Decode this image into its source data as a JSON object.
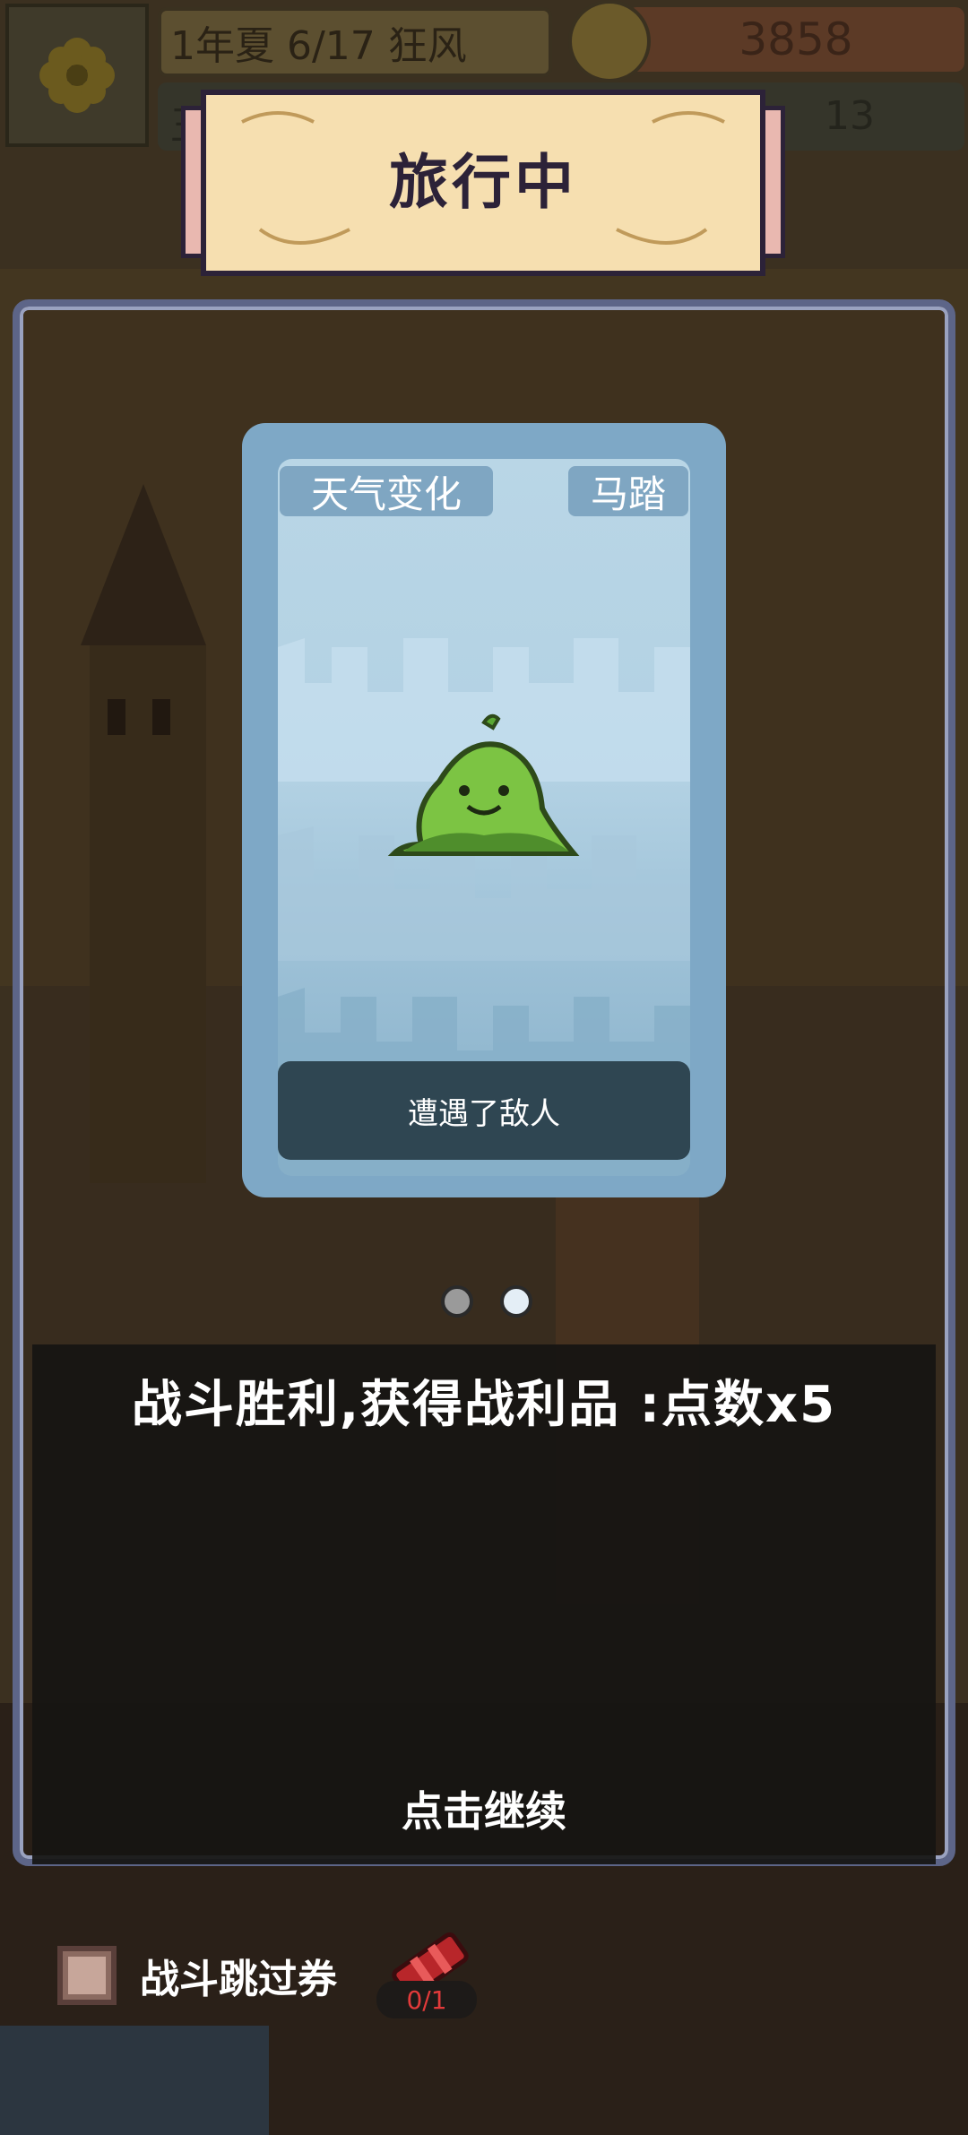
{
  "hud": {
    "date": "1年夏 6/17 狂风",
    "money": "3858",
    "sub_left": "王",
    "sub_right": "13"
  },
  "banner": {
    "title": "旅行中"
  },
  "card": {
    "tag_weather": "天气变化",
    "tag_road": "马踏",
    "event": "遭遇了敌人"
  },
  "pager": {
    "current": 2,
    "total": 2
  },
  "dialog": {
    "result": "战斗胜利,获得战利品 :点数x5",
    "continue": "点击继续"
  },
  "skip": {
    "label": "战斗跳过券",
    "count": "0/1"
  },
  "colors": {
    "panel_border": "#5d6588",
    "card_bg": "#7ea8c6",
    "banner_bg": "#f6dfb0",
    "slime": "#7cc443"
  }
}
